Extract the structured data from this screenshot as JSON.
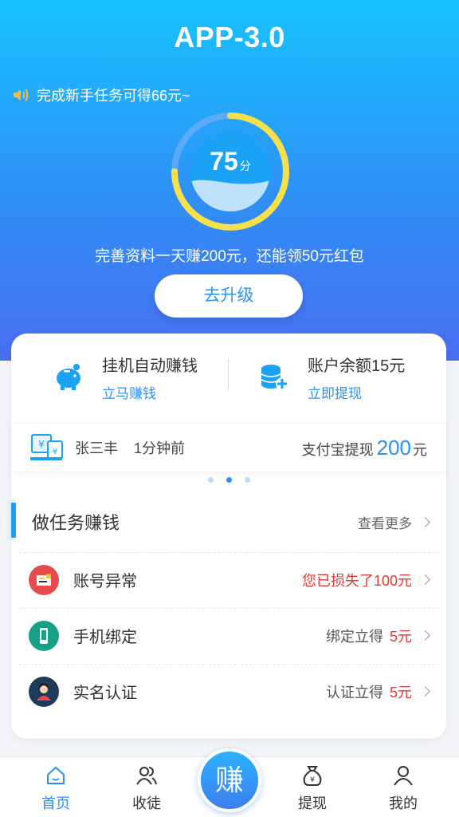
{
  "header": {
    "title": "APP-3.0",
    "notice": "完成新手任务可得66元~",
    "score": "75",
    "score_unit": "分",
    "score_progress": 0.75,
    "tip": "完善资料一天赚200元，还能领50元红包",
    "upgrade_label": "去升级"
  },
  "quick": {
    "left_title": "挂机自动赚钱",
    "left_link": "立马赚钱",
    "right_title": "账户余额15元",
    "right_link": "立即提现"
  },
  "ticker": {
    "name": "张三丰",
    "time": "1分钟前",
    "label": "支付宝提现",
    "amount": "200",
    "unit": "元"
  },
  "carousel": {
    "count": 3,
    "active": 1
  },
  "tasks": {
    "title": "做任务赚钱",
    "more": "查看更多",
    "items": [
      {
        "name": "账号异常",
        "note": "您已损失了100元",
        "reward": "",
        "icon": "account-warning-icon",
        "color": "#e84b4b"
      },
      {
        "name": "手机绑定",
        "note": "绑定立得",
        "reward": "5元",
        "icon": "phone-icon",
        "color": "#16a085"
      },
      {
        "name": "实名认证",
        "note": "认证立得",
        "reward": "5元",
        "icon": "person-icon",
        "color": "#1f3b5a"
      }
    ]
  },
  "tabbar": {
    "home": "首页",
    "apprentice": "收徒",
    "earn": "赚",
    "withdraw": "提现",
    "mine": "我的"
  },
  "colors": {
    "accent": "#2a90f2",
    "gauge": "#f7e04a",
    "red": "#e53935"
  }
}
